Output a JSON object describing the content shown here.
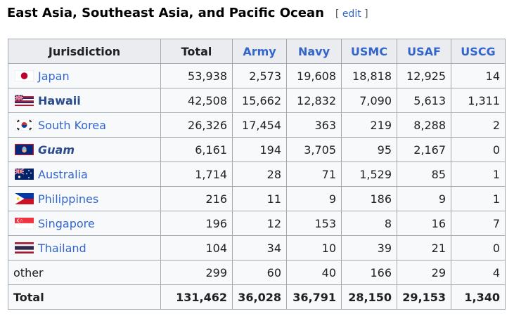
{
  "section": {
    "title": "East Asia, Southeast Asia, and Pacific Ocean",
    "edit_open": "[ ",
    "edit_label": "edit",
    "edit_close": " ]"
  },
  "table": {
    "headers": [
      "Jurisdiction",
      "Total",
      "Army",
      "Navy",
      "USMC",
      "USAF",
      "USCG"
    ],
    "rows": [
      {
        "name": "Japan",
        "flag": "japan-flag-icon",
        "values": [
          "53,938",
          "2,573",
          "19,608",
          "18,818",
          "12,925",
          "14"
        ]
      },
      {
        "name": "Hawaii",
        "flag": "hawaii-flag-icon",
        "values": [
          "42,508",
          "15,662",
          "12,832",
          "7,090",
          "5,613",
          "1,311"
        ]
      },
      {
        "name": "South Korea",
        "flag": "south-korea-flag-icon",
        "values": [
          "26,326",
          "17,454",
          "363",
          "219",
          "8,288",
          "2"
        ]
      },
      {
        "name": "Guam",
        "flag": "guam-flag-icon",
        "values": [
          "6,161",
          "194",
          "3,705",
          "95",
          "2,167",
          "0"
        ]
      },
      {
        "name": "Australia",
        "flag": "australia-flag-icon",
        "values": [
          "1,714",
          "28",
          "71",
          "1,529",
          "85",
          "1"
        ]
      },
      {
        "name": "Philippines",
        "flag": "philippines-flag-icon",
        "values": [
          "216",
          "11",
          "9",
          "186",
          "9",
          "1"
        ]
      },
      {
        "name": "Singapore",
        "flag": "singapore-flag-icon",
        "values": [
          "196",
          "12",
          "153",
          "8",
          "16",
          "7"
        ]
      },
      {
        "name": "Thailand",
        "flag": "thailand-flag-icon",
        "values": [
          "104",
          "34",
          "10",
          "39",
          "21",
          "0"
        ]
      },
      {
        "name": "other",
        "values": [
          "299",
          "60",
          "40",
          "166",
          "29",
          "4"
        ]
      }
    ],
    "total": {
      "name": "Total",
      "values": [
        "131,462",
        "36,028",
        "36,791",
        "28,150",
        "29,153",
        "1,340"
      ]
    }
  },
  "colors": {
    "link": "#3366cc",
    "header_bg": "#eaecf0",
    "cell_bg": "#f8f9fa",
    "border": "#a2a9b1"
  }
}
